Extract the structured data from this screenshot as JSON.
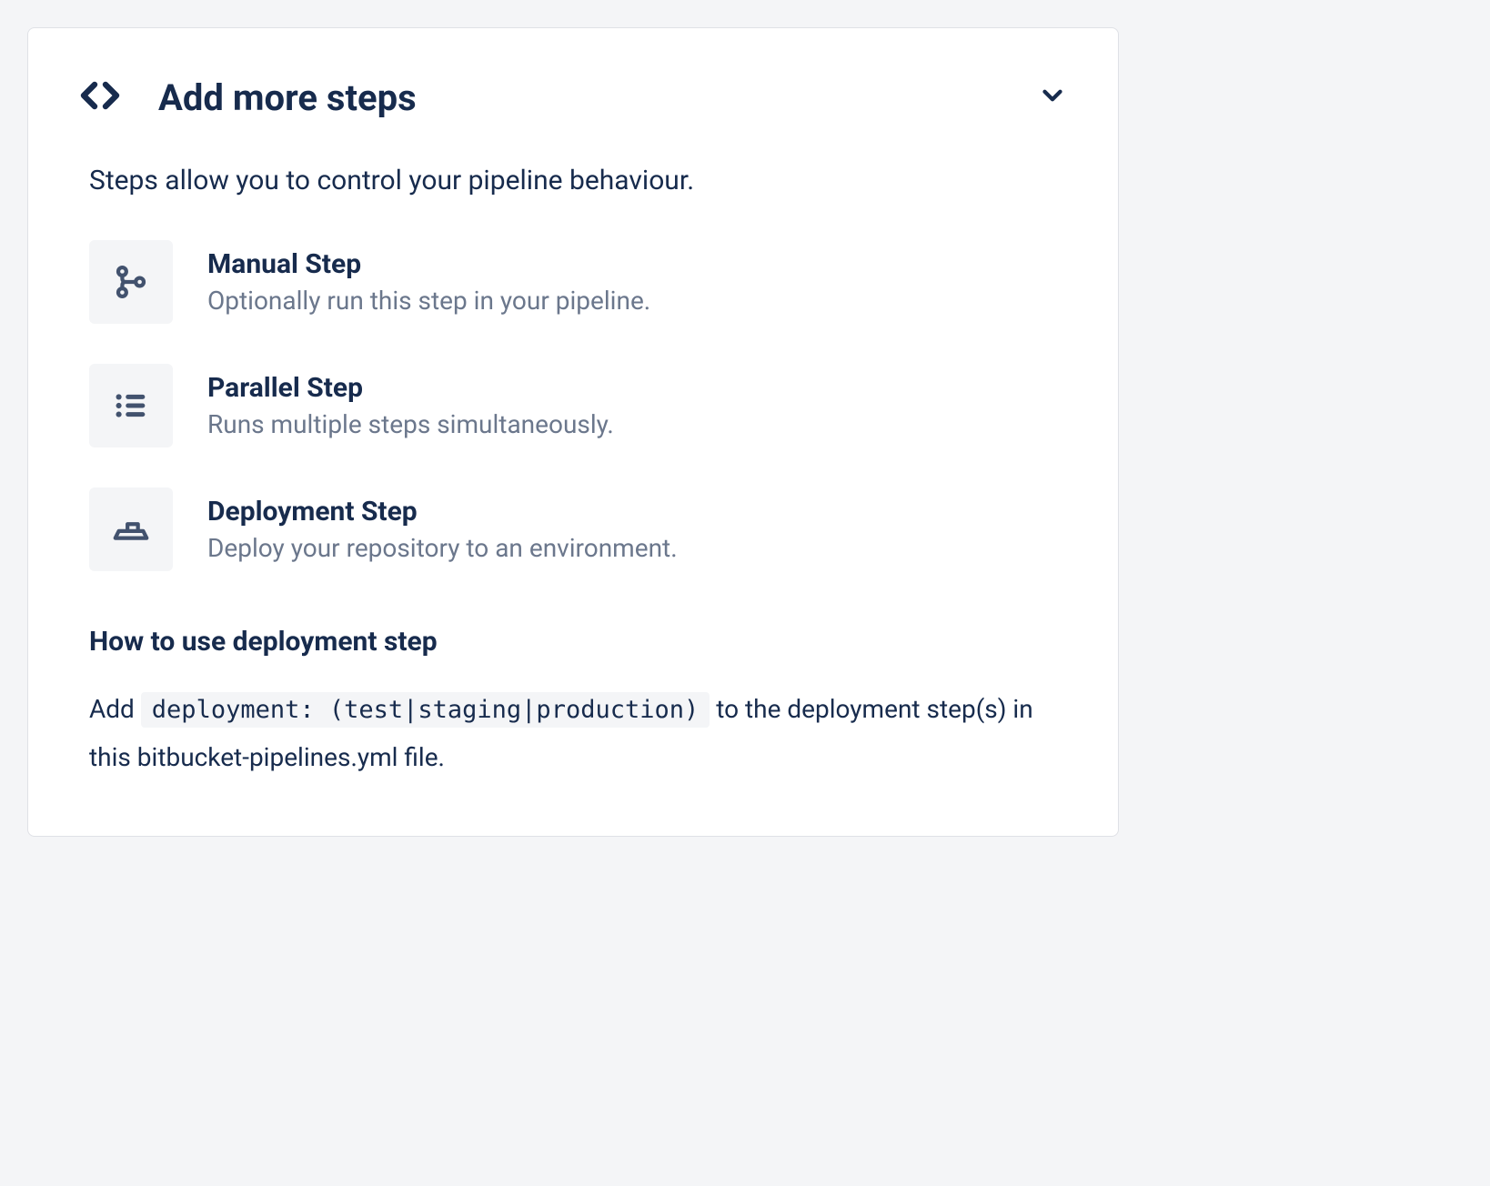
{
  "header": {
    "title": "Add more steps"
  },
  "intro": "Steps allow you to control your pipeline behaviour.",
  "steps": [
    {
      "title": "Manual Step",
      "desc": "Optionally run this step in your pipeline."
    },
    {
      "title": "Parallel Step",
      "desc": "Runs multiple steps simultaneously."
    },
    {
      "title": "Deployment Step",
      "desc": "Deploy your repository to an environment."
    }
  ],
  "howto": {
    "title": "How to use deployment step",
    "prefix": "Add ",
    "code": "deployment: (test|staging|production)",
    "suffix": " to the deployment step(s) in this bitbucket-pipelines.yml file."
  }
}
